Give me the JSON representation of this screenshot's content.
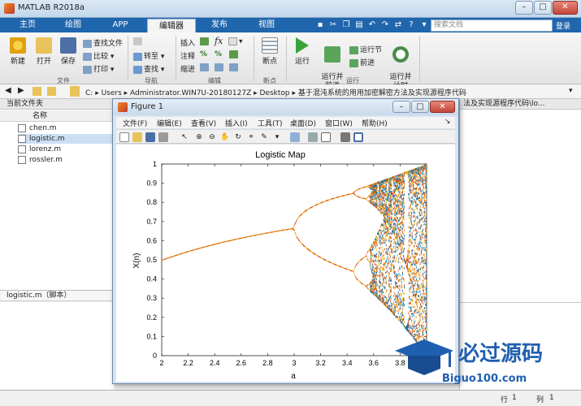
{
  "app": {
    "title": "MATLAB R2018a"
  },
  "tabs": [
    {
      "label": "主页"
    },
    {
      "label": "绘图"
    },
    {
      "label": "APP"
    },
    {
      "label": "编辑器"
    },
    {
      "label": "发布"
    },
    {
      "label": "视图"
    }
  ],
  "search": {
    "placeholder": "搜索文档",
    "login": "登录"
  },
  "ribbon": {
    "file": {
      "new": "新建",
      "open": "打开",
      "save": "保存",
      "find_files": "查找文件",
      "compare": "比较",
      "print": "打印",
      "group": "文件"
    },
    "nav": {
      "goto": "转至",
      "find": "查找",
      "group": "导航"
    },
    "edit": {
      "insert": "插入",
      "comment": "注释",
      "indent": "缩进",
      "group": "编辑",
      "fx": "fx"
    },
    "breakpoints": {
      "label": "断点",
      "group": "断点"
    },
    "run": {
      "run": "运行",
      "run_advance": "运行并\n前进",
      "run_section": "运行节",
      "advance": "前进",
      "run_time": "运行并\n计时",
      "group": "运行"
    }
  },
  "address": {
    "segments": [
      "C:",
      "Users",
      "Administrator.WIN7U-20180127Z",
      "Desktop",
      "基于混沌系统的用用加密解密方法及实现源程序代码"
    ]
  },
  "left_panel": {
    "title": "当前文件夹",
    "column": "名称",
    "files": [
      {
        "name": "chen.m"
      },
      {
        "name": "logistic.m"
      },
      {
        "name": "lorenz.m"
      },
      {
        "name": "rossler.m"
      }
    ],
    "details": "logistic.m（脚本）"
  },
  "right_panel": {
    "title": "法及实现源程序代码\\lo..."
  },
  "status": {
    "row_label": "行",
    "row": "1",
    "col_label": "列",
    "col": "1"
  },
  "figure": {
    "title": "Figure 1",
    "menu": [
      "文件(F)",
      "编辑(E)",
      "查看(V)",
      "插入(I)",
      "工具(T)",
      "桌面(D)",
      "窗口(W)",
      "帮助(H)"
    ]
  },
  "watermark": {
    "main": "必过源码",
    "sub": "Biguo100.com"
  },
  "chart_data": {
    "type": "scatter",
    "title": "Logistic Map",
    "xlabel": "a",
    "ylabel": "X(n)",
    "xlim": [
      2,
      4
    ],
    "ylim": [
      0,
      1
    ],
    "xticks": [
      "2",
      "2.2",
      "2.4",
      "2.6",
      "2.8",
      "3",
      "3.2",
      "3.4",
      "3.6",
      "3.8"
    ],
    "yticks": [
      "0",
      "0.1",
      "0.2",
      "0.3",
      "0.4",
      "0.5",
      "0.6",
      "0.7",
      "0.8",
      "0.9",
      "1"
    ],
    "series_colors": [
      "#d95319",
      "#edb120",
      "#0072bd"
    ],
    "fixed_point_a": [
      2.0,
      2.2,
      2.4,
      2.6,
      2.8,
      3.0
    ],
    "fixed_point_x": [
      0.5,
      0.545,
      0.583,
      0.615,
      0.643,
      0.667
    ]
  }
}
